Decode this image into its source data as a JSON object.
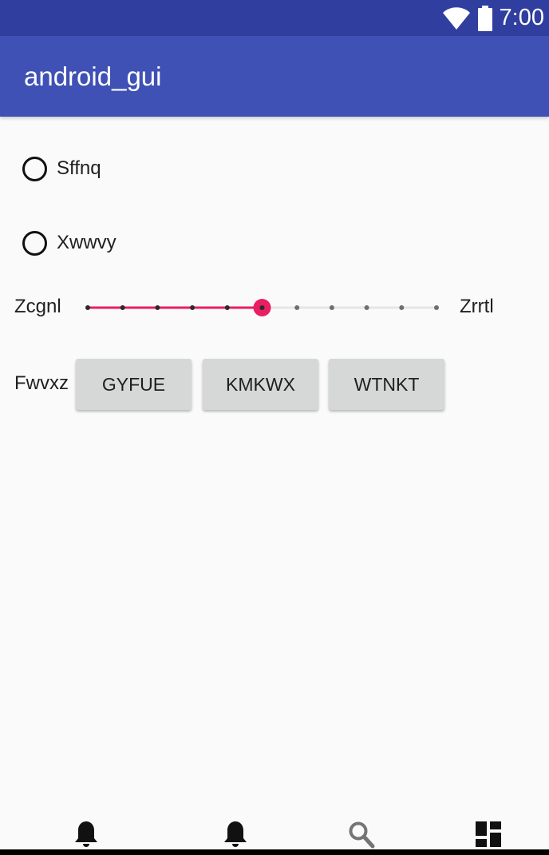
{
  "status_bar": {
    "time": "7:00",
    "icons": [
      "wifi-icon",
      "battery-icon"
    ]
  },
  "app_bar": {
    "title": "android_gui"
  },
  "radios": [
    {
      "label": "Sffnq",
      "checked": false
    },
    {
      "label": "Xwwvy",
      "checked": false
    }
  ],
  "seekbar": {
    "left_label": "Zcgnl",
    "right_label": "Zrrtl",
    "steps": 10,
    "value": 5,
    "accent_color": "#e91e63"
  },
  "button_group": {
    "label": "Fwvxz",
    "buttons": [
      "GYFUE",
      "KMKWX",
      "WTNKT"
    ]
  },
  "bottom_nav": {
    "items": [
      "bell-icon",
      "bell-icon",
      "search-icon",
      "dashboard-icon"
    ]
  },
  "colors": {
    "status_bar": "#303f9f",
    "app_bar": "#3f51b5",
    "accent": "#e91e63",
    "button": "#d6d7d7"
  }
}
